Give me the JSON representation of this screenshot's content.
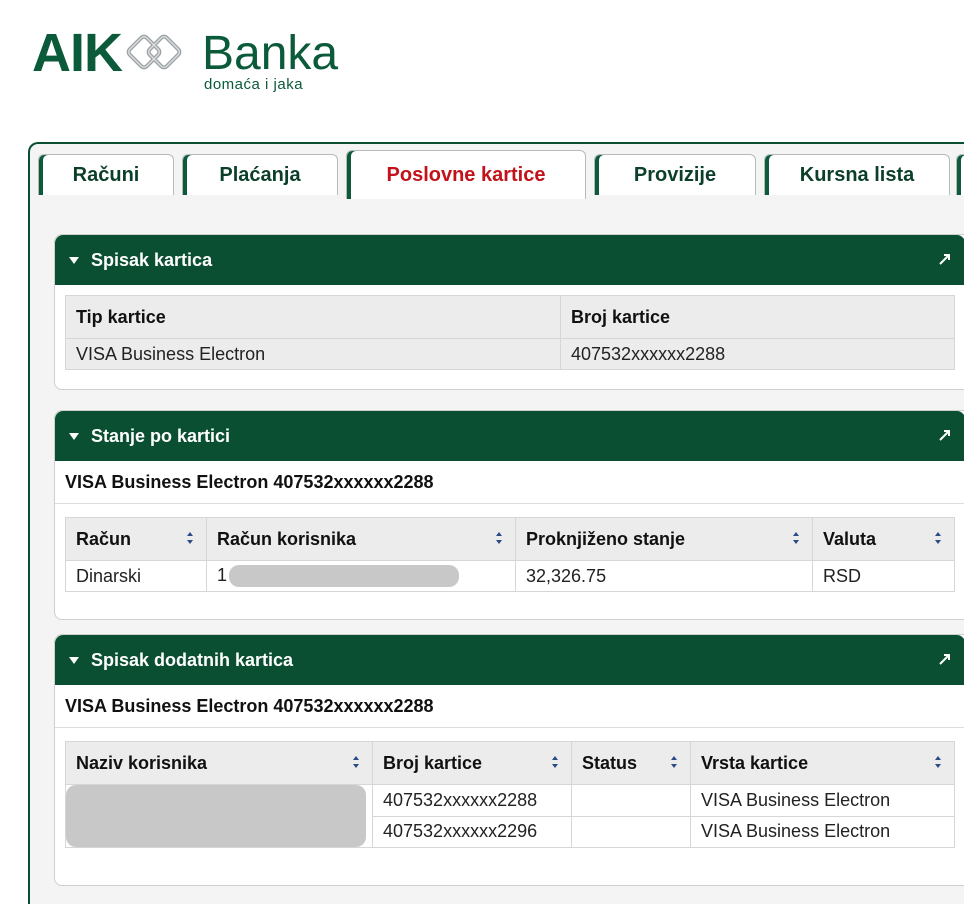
{
  "logo": {
    "brand_left": "AIK",
    "brand_right": "Banka",
    "tagline": "domaća i jaka"
  },
  "tabs": [
    {
      "label": "Računi"
    },
    {
      "label": "Plaćanja"
    },
    {
      "label": "Poslovne kartice",
      "active": true
    },
    {
      "label": "Provizije"
    },
    {
      "label": "Kursna lista"
    }
  ],
  "panel1": {
    "title": "Spisak kartica",
    "columns": [
      "Tip kartice",
      "Broj kartice"
    ],
    "rows": [
      [
        "VISA Business Electron",
        "407532xxxxxx2288"
      ]
    ]
  },
  "panel2": {
    "title": "Stanje po kartici",
    "subtitle": "VISA Business Electron 407532xxxxxx2288",
    "columns": [
      "Račun",
      "Račun korisnika",
      "Proknjiženo stanje",
      "Valuta"
    ],
    "rows": [
      [
        "Dinarski",
        "1",
        "32,326.75",
        "RSD"
      ]
    ]
  },
  "panel3": {
    "title": "Spisak dodatnih kartica",
    "subtitle": "VISA Business Electron 407532xxxxxx2288",
    "columns": [
      "Naziv korisnika",
      "Broj kartice",
      "Status",
      "Vrsta kartice"
    ],
    "rows": [
      [
        "",
        "407532xxxxxx2288",
        "",
        "VISA Business Electron"
      ],
      [
        "",
        "407532xxxxxx2296",
        "",
        "VISA Business Electron"
      ]
    ]
  },
  "colors": {
    "brand_green": "#0b4f33",
    "active_tab_text": "#c2131a"
  },
  "icons": {
    "collapse": "triangle-down-icon",
    "maximize": "maximize-arrow-icon",
    "sort": "sort-arrows-icon"
  }
}
